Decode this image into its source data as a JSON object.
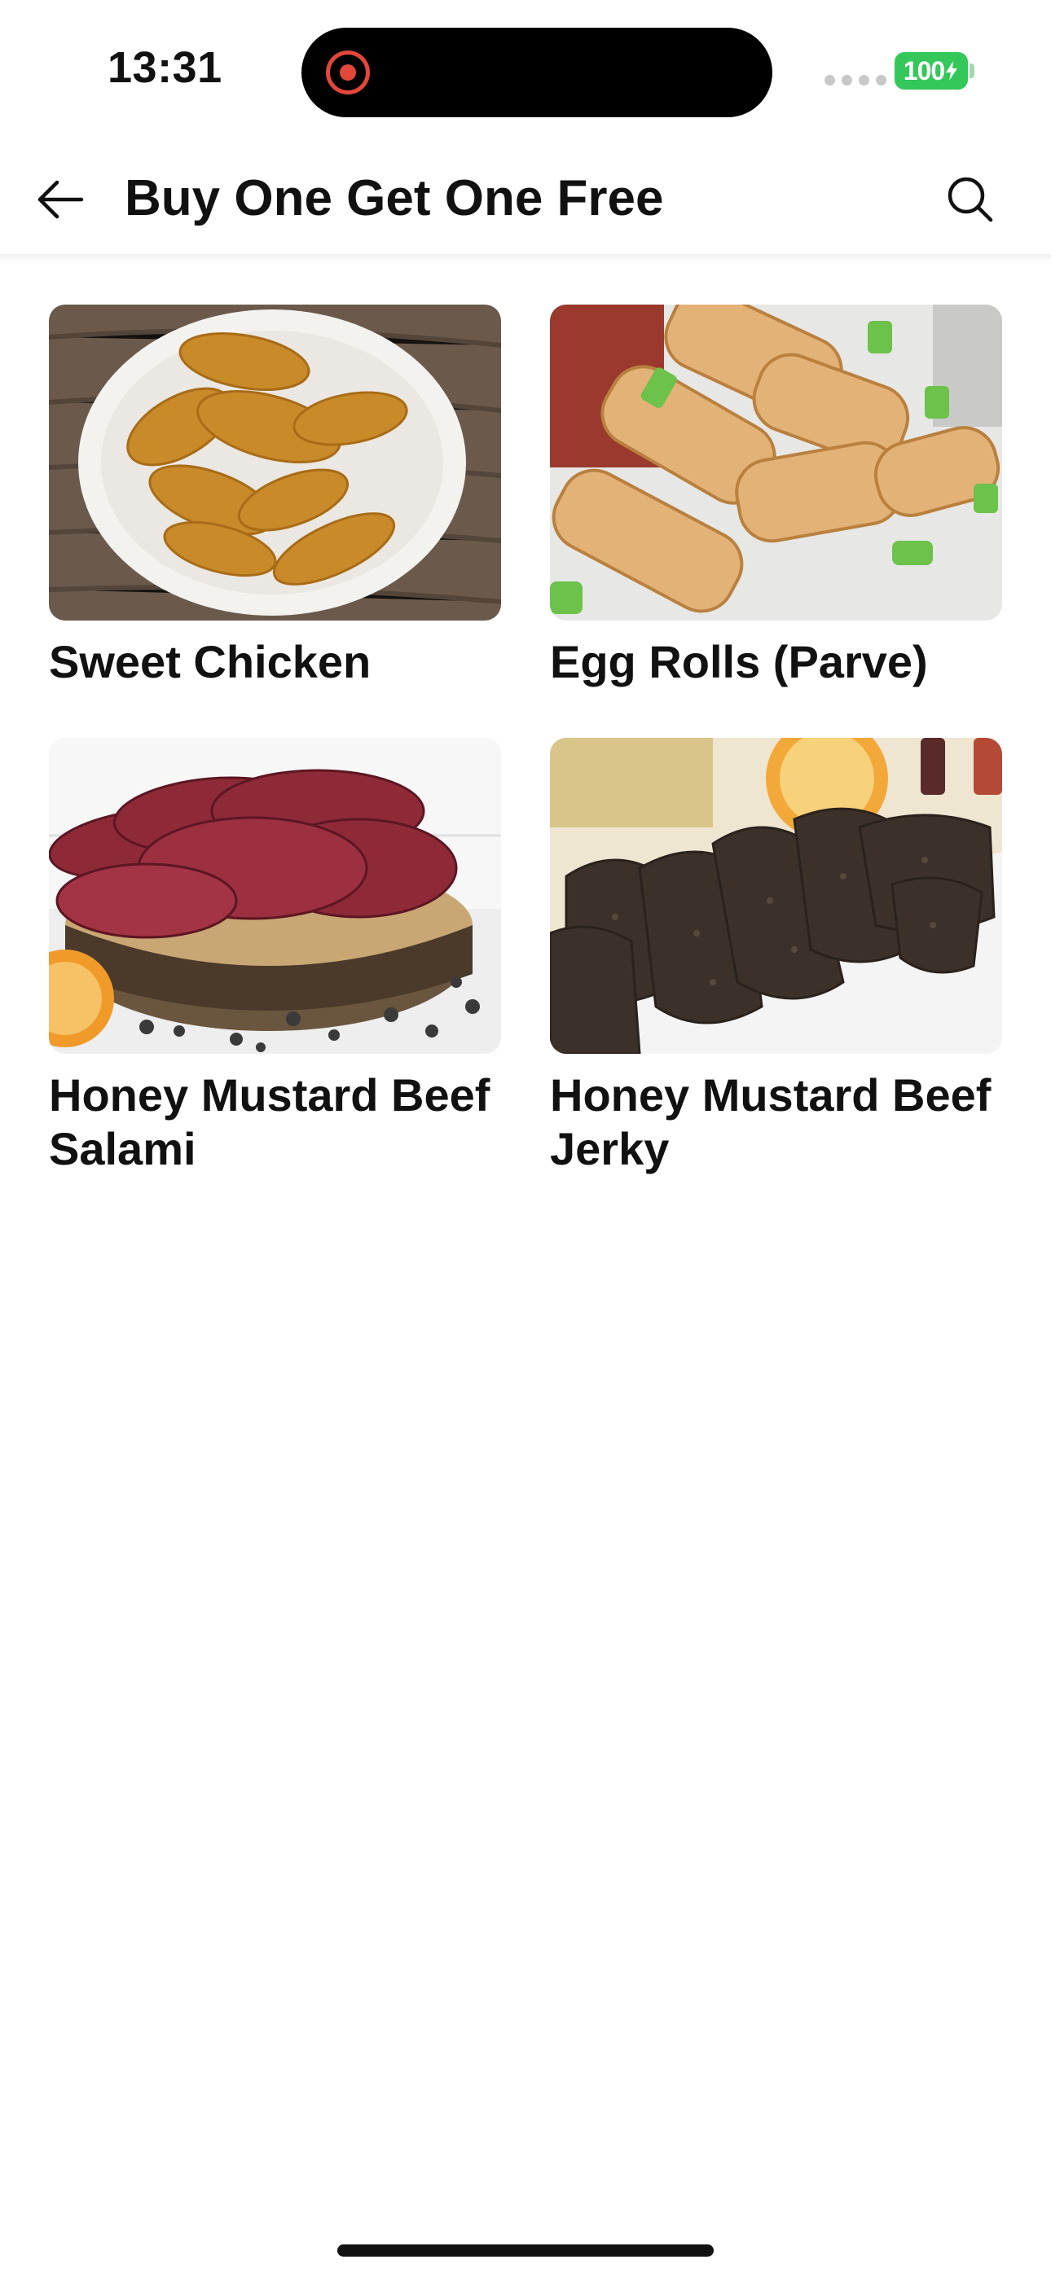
{
  "status_bar": {
    "time": "13:31",
    "battery": "100",
    "battery_color": "#34c759",
    "recording_color": "#e2483a"
  },
  "header": {
    "back_icon": "arrow-left-icon",
    "title": "Buy One Get One Free",
    "search_icon": "search-icon"
  },
  "products": [
    {
      "name": "Sweet Chicken",
      "image": "fried chicken tenders on a white plate"
    },
    {
      "name": "Egg Rolls (Parve)",
      "image": "fried egg rolls with green onion"
    },
    {
      "name": "Honey Mustard Beef Salami",
      "image": "sliced beef salami on a wooden board"
    },
    {
      "name": "Honey Mustard Beef Jerky",
      "image": "beef jerky pieces on a white tray"
    }
  ]
}
